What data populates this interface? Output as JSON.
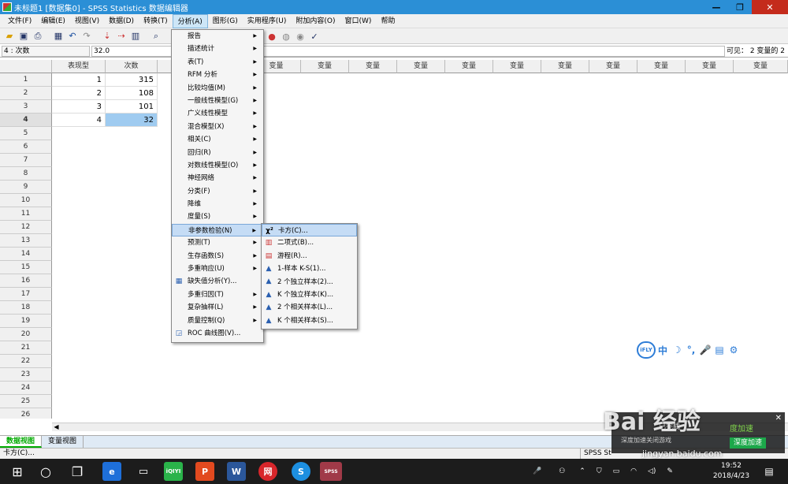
{
  "window": {
    "title": "未标题1 [数据集0] - SPSS Statistics 数据编辑器"
  },
  "window_controls": {
    "minimize": "—",
    "restore": "❐",
    "close": "✕"
  },
  "menubar": [
    {
      "label": "文件(F)"
    },
    {
      "label": "编辑(E)"
    },
    {
      "label": "视图(V)"
    },
    {
      "label": "数据(D)"
    },
    {
      "label": "转换(T)"
    },
    {
      "label": "分析(A)"
    },
    {
      "label": "图形(G)"
    },
    {
      "label": "实用程序(U)"
    },
    {
      "label": "附加内容(O)"
    },
    {
      "label": "窗口(W)"
    },
    {
      "label": "帮助"
    }
  ],
  "editbar": {
    "cell_ref": "4 : 次数",
    "cell_value": "32.0",
    "visible": "可见：  2 变量的 2"
  },
  "grid": {
    "columns": [
      "表现型",
      "次数",
      "变量",
      "变量",
      "变量",
      "变量",
      "变量",
      "变量",
      "变量",
      "变量",
      "变量",
      "变量",
      "变量",
      "变量",
      "变量"
    ],
    "rows": [
      "1",
      "2",
      "3",
      "4",
      "5",
      "6",
      "7",
      "8",
      "9",
      "10",
      "11",
      "12",
      "13",
      "14",
      "15",
      "16",
      "17",
      "18",
      "19",
      "20",
      "21",
      "22",
      "23",
      "24",
      "25",
      "26"
    ],
    "data": [
      {
        "phenotype": "1",
        "count": "315"
      },
      {
        "phenotype": "2",
        "count": "108"
      },
      {
        "phenotype": "3",
        "count": "101"
      },
      {
        "phenotype": "4",
        "count": "32"
      }
    ]
  },
  "analyze_menu": [
    {
      "label": "报告",
      "sub": true
    },
    {
      "label": "描述统计",
      "sub": true
    },
    {
      "label": "表(T)",
      "sub": true
    },
    {
      "label": "RFM 分析",
      "sub": true
    },
    {
      "label": "比较均值(M)",
      "sub": true
    },
    {
      "label": "一般线性模型(G)",
      "sub": true
    },
    {
      "label": "广义线性模型",
      "sub": true
    },
    {
      "label": "混合模型(X)",
      "sub": true
    },
    {
      "label": "相关(C)",
      "sub": true
    },
    {
      "label": "回归(R)",
      "sub": true
    },
    {
      "label": "对数线性模型(O)",
      "sub": true
    },
    {
      "label": "神经网络",
      "sub": true
    },
    {
      "label": "分类(F)",
      "sub": true
    },
    {
      "label": "降维",
      "sub": true
    },
    {
      "label": "度量(S)",
      "sub": true
    },
    {
      "label": "非参数检验(N)",
      "sub": true
    },
    {
      "label": "预测(T)",
      "sub": true
    },
    {
      "label": "生存函数(S)",
      "sub": true
    },
    {
      "label": "多重响应(U)",
      "sub": true
    },
    {
      "label": "缺失值分析(Y)...",
      "sub": false
    },
    {
      "label": "多重归因(T)",
      "sub": true
    },
    {
      "label": "复杂抽样(L)",
      "sub": true
    },
    {
      "label": "质量控制(Q)",
      "sub": true
    },
    {
      "label": "ROC 曲线图(V)...",
      "sub": false
    }
  ],
  "nonparam_menu": [
    {
      "label": "卡方(C)..."
    },
    {
      "label": "二项式(B)..."
    },
    {
      "label": "游程(R)..."
    },
    {
      "label": "1-样本 K-S(1)..."
    },
    {
      "label": "2 个独立样本(2)..."
    },
    {
      "label": "K 个独立样本(K)..."
    },
    {
      "label": "2 个相关样本(L)..."
    },
    {
      "label": "K 个相关样本(S)..."
    }
  ],
  "tabs": [
    {
      "label": "数据视图"
    },
    {
      "label": "变量视图"
    }
  ],
  "status": {
    "left": "卡方(C)...",
    "right": "SPSS St"
  },
  "ifly": {
    "logo": "iFLY",
    "icons": [
      "中",
      "☽",
      "°,",
      "🎤",
      "▤",
      "⚙"
    ]
  },
  "popup": {
    "line1": "已完成",
    "boost": "度加速",
    "line2": "深度加速关闭游戏",
    "button": "深度加速"
  },
  "watermark": {
    "brand": "Bai 经验",
    "url": "jingyan.baidu.com"
  },
  "clock": {
    "time": "19:52",
    "date": "2018/4/23"
  },
  "taskbar_icons": [
    "○",
    "❐",
    "e",
    "iQIYI",
    "P",
    "W",
    "网",
    "S",
    "SPSS"
  ],
  "colors": {
    "titlebar": "#2b8fd6",
    "selection": "#9fcbf0",
    "menu_highlight": "#c5dcf5",
    "taskbar": "#1c1c1c"
  }
}
